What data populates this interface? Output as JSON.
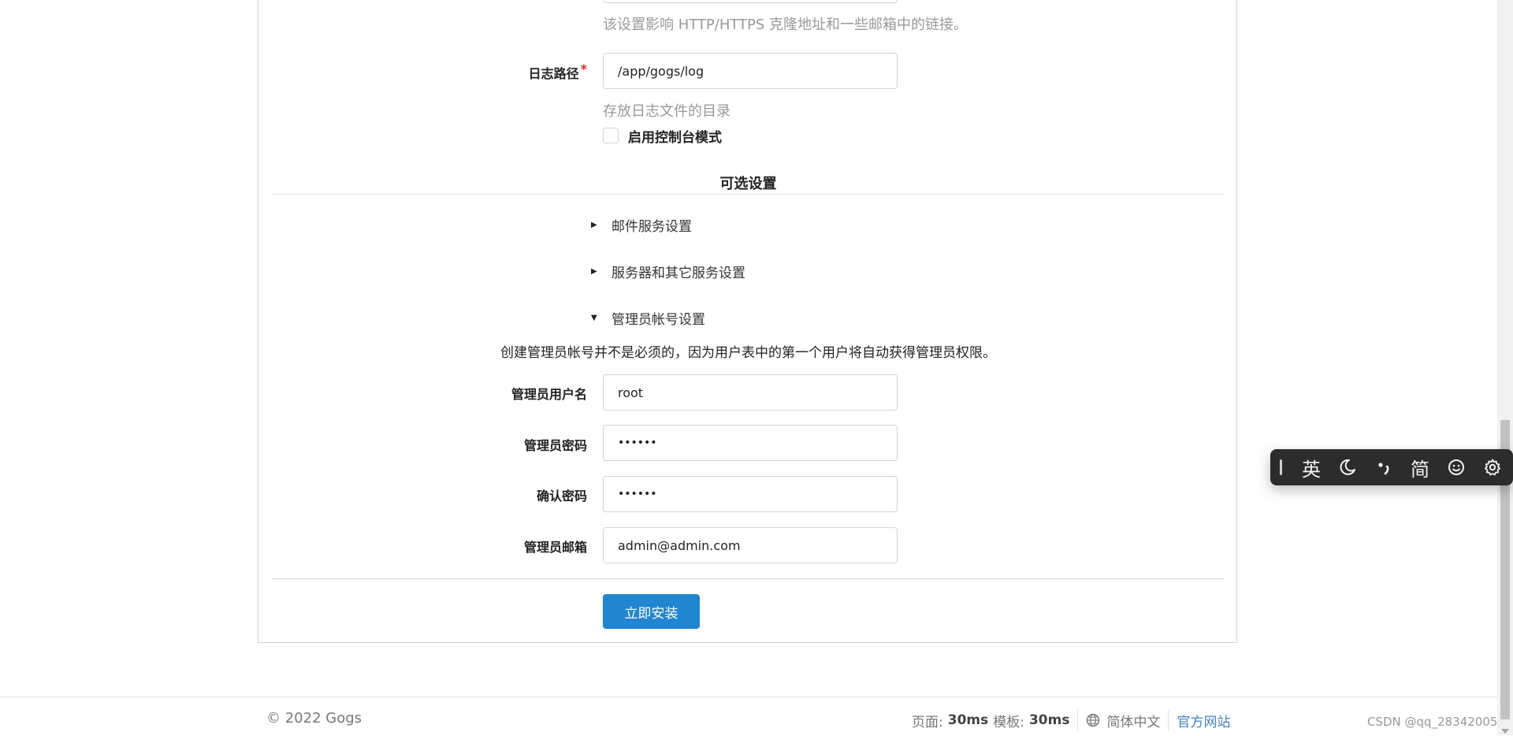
{
  "app_url_help": "该设置影响 HTTP/HTTPS 克隆地址和一些邮箱中的链接。",
  "log_path": {
    "label": "日志路径",
    "required_mark": "*",
    "value": "/app/gogs/log",
    "help": "存放日志文件的目录"
  },
  "console_mode": {
    "label": "启用控制台模式",
    "checked": false
  },
  "optional_settings": {
    "title": "可选设置",
    "sections": [
      {
        "label": "邮件服务设置",
        "expanded": false
      },
      {
        "label": "服务器和其它服务设置",
        "expanded": false
      },
      {
        "label": "管理员帐号设置",
        "expanded": true
      }
    ]
  },
  "admin": {
    "note": "创建管理员帐号并不是必须的，因为用户表中的第一个用户将自动获得管理员权限。",
    "username_label": "管理员用户名",
    "username_value": "root",
    "password_label": "管理员密码",
    "password_value": "••••••",
    "confirm_label": "确认密码",
    "confirm_value": "••••••",
    "email_label": "管理员邮箱",
    "email_value": "admin@admin.com"
  },
  "submit_label": "立即安装",
  "footer": {
    "copyright": "© 2022 Gogs",
    "page_label": "页面:",
    "page_time": "30ms",
    "template_label": "模板:",
    "template_time": "30ms",
    "language": "简体中文",
    "official_site": "官方网站"
  },
  "watermark": "CSDN @qq_28342005",
  "ime_toolbar": {
    "items": [
      "英",
      "简"
    ],
    "icons": [
      "moon-icon",
      "punctuation-icon",
      "emoji-icon",
      "gear-icon"
    ]
  },
  "colors": {
    "primary_button": "#2185d0",
    "link": "#4183c4",
    "required": "#db2828"
  }
}
